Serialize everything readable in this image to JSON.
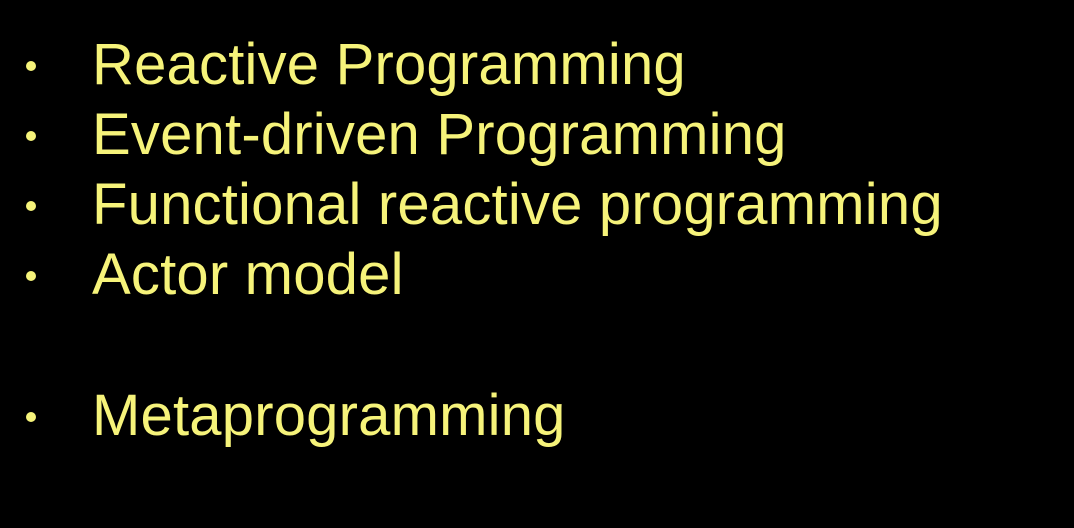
{
  "slide": {
    "text_color": "#f6f37a",
    "background_color": "#000000",
    "bullets": [
      {
        "label": "Reactive Programming"
      },
      {
        "label": "Event-driven Programming"
      },
      {
        "label": "Functional reactive programming"
      },
      {
        "label": "Actor model"
      },
      {
        "label": "Metaprogramming"
      }
    ]
  }
}
